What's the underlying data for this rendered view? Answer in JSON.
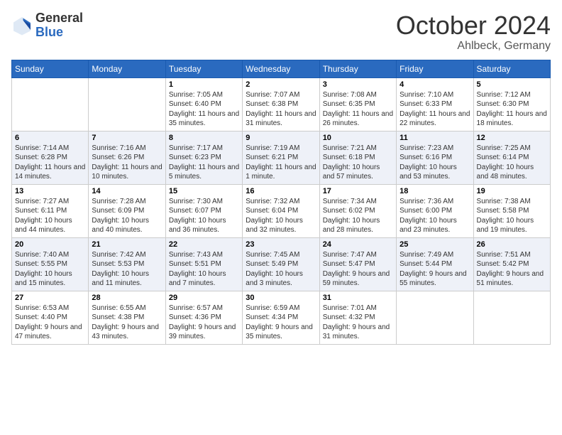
{
  "header": {
    "logo_general": "General",
    "logo_blue": "Blue",
    "title": "October 2024",
    "location": "Ahlbeck, Germany"
  },
  "days_of_week": [
    "Sunday",
    "Monday",
    "Tuesday",
    "Wednesday",
    "Thursday",
    "Friday",
    "Saturday"
  ],
  "weeks": [
    [
      {
        "day": "",
        "sunrise": "",
        "sunset": "",
        "daylight": ""
      },
      {
        "day": "",
        "sunrise": "",
        "sunset": "",
        "daylight": ""
      },
      {
        "day": "1",
        "sunrise": "Sunrise: 7:05 AM",
        "sunset": "Sunset: 6:40 PM",
        "daylight": "Daylight: 11 hours and 35 minutes."
      },
      {
        "day": "2",
        "sunrise": "Sunrise: 7:07 AM",
        "sunset": "Sunset: 6:38 PM",
        "daylight": "Daylight: 11 hours and 31 minutes."
      },
      {
        "day": "3",
        "sunrise": "Sunrise: 7:08 AM",
        "sunset": "Sunset: 6:35 PM",
        "daylight": "Daylight: 11 hours and 26 minutes."
      },
      {
        "day": "4",
        "sunrise": "Sunrise: 7:10 AM",
        "sunset": "Sunset: 6:33 PM",
        "daylight": "Daylight: 11 hours and 22 minutes."
      },
      {
        "day": "5",
        "sunrise": "Sunrise: 7:12 AM",
        "sunset": "Sunset: 6:30 PM",
        "daylight": "Daylight: 11 hours and 18 minutes."
      }
    ],
    [
      {
        "day": "6",
        "sunrise": "Sunrise: 7:14 AM",
        "sunset": "Sunset: 6:28 PM",
        "daylight": "Daylight: 11 hours and 14 minutes."
      },
      {
        "day": "7",
        "sunrise": "Sunrise: 7:16 AM",
        "sunset": "Sunset: 6:26 PM",
        "daylight": "Daylight: 11 hours and 10 minutes."
      },
      {
        "day": "8",
        "sunrise": "Sunrise: 7:17 AM",
        "sunset": "Sunset: 6:23 PM",
        "daylight": "Daylight: 11 hours and 5 minutes."
      },
      {
        "day": "9",
        "sunrise": "Sunrise: 7:19 AM",
        "sunset": "Sunset: 6:21 PM",
        "daylight": "Daylight: 11 hours and 1 minute."
      },
      {
        "day": "10",
        "sunrise": "Sunrise: 7:21 AM",
        "sunset": "Sunset: 6:18 PM",
        "daylight": "Daylight: 10 hours and 57 minutes."
      },
      {
        "day": "11",
        "sunrise": "Sunrise: 7:23 AM",
        "sunset": "Sunset: 6:16 PM",
        "daylight": "Daylight: 10 hours and 53 minutes."
      },
      {
        "day": "12",
        "sunrise": "Sunrise: 7:25 AM",
        "sunset": "Sunset: 6:14 PM",
        "daylight": "Daylight: 10 hours and 48 minutes."
      }
    ],
    [
      {
        "day": "13",
        "sunrise": "Sunrise: 7:27 AM",
        "sunset": "Sunset: 6:11 PM",
        "daylight": "Daylight: 10 hours and 44 minutes."
      },
      {
        "day": "14",
        "sunrise": "Sunrise: 7:28 AM",
        "sunset": "Sunset: 6:09 PM",
        "daylight": "Daylight: 10 hours and 40 minutes."
      },
      {
        "day": "15",
        "sunrise": "Sunrise: 7:30 AM",
        "sunset": "Sunset: 6:07 PM",
        "daylight": "Daylight: 10 hours and 36 minutes."
      },
      {
        "day": "16",
        "sunrise": "Sunrise: 7:32 AM",
        "sunset": "Sunset: 6:04 PM",
        "daylight": "Daylight: 10 hours and 32 minutes."
      },
      {
        "day": "17",
        "sunrise": "Sunrise: 7:34 AM",
        "sunset": "Sunset: 6:02 PM",
        "daylight": "Daylight: 10 hours and 28 minutes."
      },
      {
        "day": "18",
        "sunrise": "Sunrise: 7:36 AM",
        "sunset": "Sunset: 6:00 PM",
        "daylight": "Daylight: 10 hours and 23 minutes."
      },
      {
        "day": "19",
        "sunrise": "Sunrise: 7:38 AM",
        "sunset": "Sunset: 5:58 PM",
        "daylight": "Daylight: 10 hours and 19 minutes."
      }
    ],
    [
      {
        "day": "20",
        "sunrise": "Sunrise: 7:40 AM",
        "sunset": "Sunset: 5:55 PM",
        "daylight": "Daylight: 10 hours and 15 minutes."
      },
      {
        "day": "21",
        "sunrise": "Sunrise: 7:42 AM",
        "sunset": "Sunset: 5:53 PM",
        "daylight": "Daylight: 10 hours and 11 minutes."
      },
      {
        "day": "22",
        "sunrise": "Sunrise: 7:43 AM",
        "sunset": "Sunset: 5:51 PM",
        "daylight": "Daylight: 10 hours and 7 minutes."
      },
      {
        "day": "23",
        "sunrise": "Sunrise: 7:45 AM",
        "sunset": "Sunset: 5:49 PM",
        "daylight": "Daylight: 10 hours and 3 minutes."
      },
      {
        "day": "24",
        "sunrise": "Sunrise: 7:47 AM",
        "sunset": "Sunset: 5:47 PM",
        "daylight": "Daylight: 9 hours and 59 minutes."
      },
      {
        "day": "25",
        "sunrise": "Sunrise: 7:49 AM",
        "sunset": "Sunset: 5:44 PM",
        "daylight": "Daylight: 9 hours and 55 minutes."
      },
      {
        "day": "26",
        "sunrise": "Sunrise: 7:51 AM",
        "sunset": "Sunset: 5:42 PM",
        "daylight": "Daylight: 9 hours and 51 minutes."
      }
    ],
    [
      {
        "day": "27",
        "sunrise": "Sunrise: 6:53 AM",
        "sunset": "Sunset: 4:40 PM",
        "daylight": "Daylight: 9 hours and 47 minutes."
      },
      {
        "day": "28",
        "sunrise": "Sunrise: 6:55 AM",
        "sunset": "Sunset: 4:38 PM",
        "daylight": "Daylight: 9 hours and 43 minutes."
      },
      {
        "day": "29",
        "sunrise": "Sunrise: 6:57 AM",
        "sunset": "Sunset: 4:36 PM",
        "daylight": "Daylight: 9 hours and 39 minutes."
      },
      {
        "day": "30",
        "sunrise": "Sunrise: 6:59 AM",
        "sunset": "Sunset: 4:34 PM",
        "daylight": "Daylight: 9 hours and 35 minutes."
      },
      {
        "day": "31",
        "sunrise": "Sunrise: 7:01 AM",
        "sunset": "Sunset: 4:32 PM",
        "daylight": "Daylight: 9 hours and 31 minutes."
      },
      {
        "day": "",
        "sunrise": "",
        "sunset": "",
        "daylight": ""
      },
      {
        "day": "",
        "sunrise": "",
        "sunset": "",
        "daylight": ""
      }
    ]
  ]
}
